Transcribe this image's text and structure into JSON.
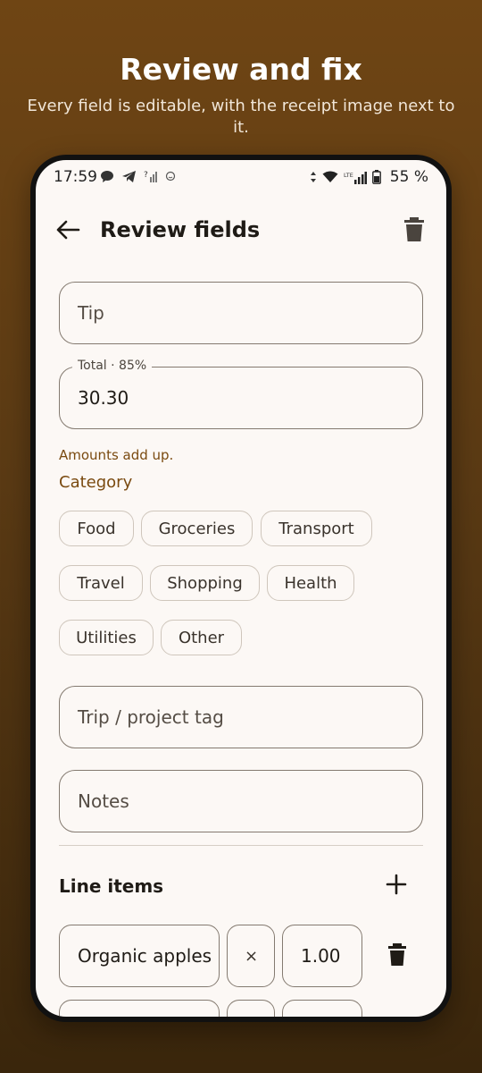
{
  "promo": {
    "title": "Review and fix",
    "subtitle": "Every field is editable, with the receipt image next to it."
  },
  "status_bar": {
    "time": "17:59",
    "battery": "55 %",
    "network": "LTE"
  },
  "app_bar": {
    "title": "Review fields"
  },
  "fields": {
    "tip": {
      "placeholder": "Tip"
    },
    "total": {
      "label": "Total · 85%",
      "value": "30.30",
      "support": "Amounts add up."
    },
    "trip_tag": {
      "placeholder": "Trip / project tag"
    },
    "notes": {
      "placeholder": "Notes"
    }
  },
  "category": {
    "label": "Category",
    "chips": [
      "Food",
      "Groceries",
      "Transport",
      "Travel",
      "Shopping",
      "Health",
      "Utilities",
      "Other"
    ]
  },
  "line_items": {
    "title": "Line items",
    "rows": [
      {
        "name": "Organic apples",
        "multiplier": "×",
        "quantity": "1.00"
      },
      {
        "name": "",
        "multiplier": "",
        "quantity": ""
      }
    ]
  },
  "colors": {
    "accent": "#7a4a10",
    "background": "#fcf8f5",
    "outline": "#847a70"
  }
}
